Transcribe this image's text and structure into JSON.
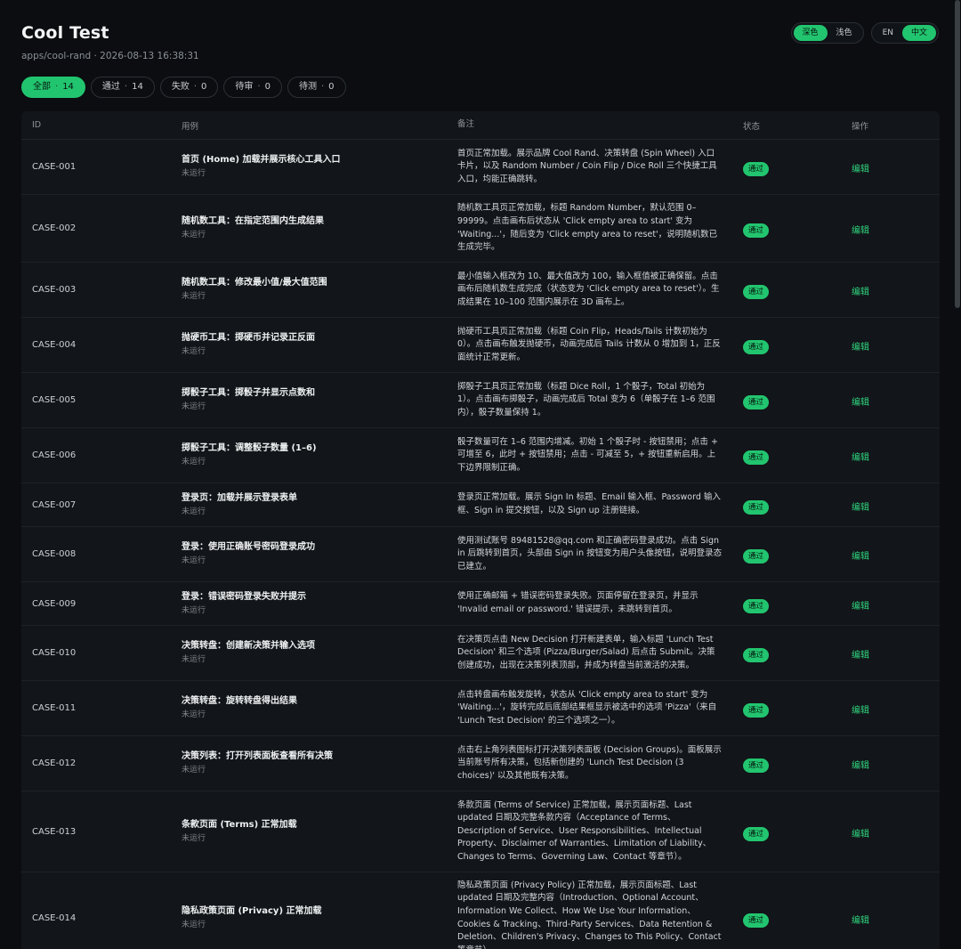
{
  "header": {
    "title": "Cool Test",
    "subtitle": "apps/cool-rand · 2026-08-13 16:38:31"
  },
  "theme_toggle": {
    "dark": "深色",
    "light": "浅色"
  },
  "lang_toggle": {
    "en": "EN",
    "zh": "中文"
  },
  "filters": [
    {
      "label": "全部",
      "count": "14"
    },
    {
      "label": "通过",
      "count": "14"
    },
    {
      "label": "失败",
      "count": "0"
    },
    {
      "label": "待审",
      "count": "0"
    },
    {
      "label": "待测",
      "count": "0"
    }
  ],
  "table": {
    "headers": {
      "id": "ID",
      "case": "用例",
      "note": "备注",
      "status": "状态",
      "op": "操作"
    },
    "rows": [
      {
        "id": "CASE-001",
        "title": "首页 (Home) 加载并展示核心工具入口",
        "sub": "未运行",
        "note": "首页正常加载。展示品牌 Cool Rand、决策转盘 (Spin Wheel) 入口卡片，以及 Random Number / Coin Flip / Dice Roll 三个快捷工具入口，均能正确跳转。",
        "status": "通过",
        "op": "编辑"
      },
      {
        "id": "CASE-002",
        "title": "随机数工具：在指定范围内生成结果",
        "sub": "未运行",
        "note": "随机数工具页正常加载，标题 Random Number，默认范围 0–99999。点击画布后状态从 'Click empty area to start' 变为 'Waiting...'，随后变为 'Click empty area to reset'，说明随机数已生成完毕。",
        "status": "通过",
        "op": "编辑"
      },
      {
        "id": "CASE-003",
        "title": "随机数工具：修改最小值/最大值范围",
        "sub": "未运行",
        "note": "最小值输入框改为 10、最大值改为 100，输入框值被正确保留。点击画布后随机数生成完成（状态变为 'Click empty area to reset'）。生成结果在 10–100 范围内展示在 3D 画布上。",
        "status": "通过",
        "op": "编辑"
      },
      {
        "id": "CASE-004",
        "title": "抛硬币工具：掷硬币并记录正反面",
        "sub": "未运行",
        "note": "抛硬币工具页正常加载（标题 Coin Flip，Heads/Tails 计数初始为 0）。点击画布触发抛硬币，动画完成后 Tails 计数从 0 增加到 1，正反面统计正常更新。",
        "status": "通过",
        "op": "编辑"
      },
      {
        "id": "CASE-005",
        "title": "掷骰子工具：掷骰子并显示点数和",
        "sub": "未运行",
        "note": "掷骰子工具页正常加载（标题 Dice Roll，1 个骰子，Total 初始为 1）。点击画布掷骰子，动画完成后 Total 变为 6（单骰子在 1–6 范围内），骰子数量保持 1。",
        "status": "通过",
        "op": "编辑"
      },
      {
        "id": "CASE-006",
        "title": "掷骰子工具：调整骰子数量 (1–6)",
        "sub": "未运行",
        "note": "骰子数量可在 1–6 范围内增减。初始 1 个骰子时 - 按钮禁用；点击 + 可增至 6，此时 + 按钮禁用；点击 - 可减至 5，+ 按钮重新启用。上下边界限制正确。",
        "status": "通过",
        "op": "编辑"
      },
      {
        "id": "CASE-007",
        "title": "登录页：加载并展示登录表单",
        "sub": "未运行",
        "note": "登录页正常加载。展示 Sign In 标题、Email 输入框、Password 输入框、Sign in 提交按钮，以及 Sign up 注册链接。",
        "status": "通过",
        "op": "编辑"
      },
      {
        "id": "CASE-008",
        "title": "登录：使用正确账号密码登录成功",
        "sub": "未运行",
        "note": "使用测试账号 89481528@qq.com 和正确密码登录成功。点击 Sign in 后跳转到首页，头部由 Sign in 按钮变为用户头像按钮，说明登录态已建立。",
        "status": "通过",
        "op": "编辑"
      },
      {
        "id": "CASE-009",
        "title": "登录：错误密码登录失败并提示",
        "sub": "未运行",
        "note": "使用正确邮箱 + 错误密码登录失败。页面停留在登录页，并显示 'Invalid email or password.' 错误提示，未跳转到首页。",
        "status": "通过",
        "op": "编辑"
      },
      {
        "id": "CASE-010",
        "title": "决策转盘：创建新决策并输入选项",
        "sub": "未运行",
        "note": "在决策页点击 New Decision 打开新建表单，输入标题 'Lunch Test Decision' 和三个选项 (Pizza/Burger/Salad) 后点击 Submit。决策创建成功，出现在决策列表顶部，并成为转盘当前激活的决策。",
        "status": "通过",
        "op": "编辑"
      },
      {
        "id": "CASE-011",
        "title": "决策转盘：旋转转盘得出结果",
        "sub": "未运行",
        "note": "点击转盘画布触发旋转，状态从 'Click empty area to start' 变为 'Waiting...'，旋转完成后底部结果框显示被选中的选项 'Pizza'（来自 'Lunch Test Decision' 的三个选项之一）。",
        "status": "通过",
        "op": "编辑"
      },
      {
        "id": "CASE-012",
        "title": "决策列表：打开列表面板查看所有决策",
        "sub": "未运行",
        "note": "点击右上角列表图标打开决策列表面板 (Decision Groups)。面板展示当前账号所有决策，包括新创建的 'Lunch Test Decision (3 choices)' 以及其他既有决策。",
        "status": "通过",
        "op": "编辑"
      },
      {
        "id": "CASE-013",
        "title": "条款页面 (Terms) 正常加载",
        "sub": "未运行",
        "note": "条款页面 (Terms of Service) 正常加载，展示页面标题、Last updated 日期及完整条款内容（Acceptance of Terms、Description of Service、User Responsibilities、Intellectual Property、Disclaimer of Warranties、Limitation of Liability、Changes to Terms、Governing Law、Contact 等章节）。",
        "status": "通过",
        "op": "编辑"
      },
      {
        "id": "CASE-014",
        "title": "隐私政策页面 (Privacy) 正常加载",
        "sub": "未运行",
        "note": "隐私政策页面 (Privacy Policy) 正常加载，展示页面标题、Last updated 日期及完整内容（Introduction、Optional Account、Information We Collect、How We Use Your Information、Cookies & Tracking、Third-Party Services、Data Retention & Deletion、Children's Privacy、Changes to This Policy、Contact 等章节）。",
        "status": "通过",
        "op": "编辑"
      }
    ]
  },
  "colors": {
    "accent": "#22c56f",
    "background": "#0b0d10",
    "table_bg": "#121519"
  }
}
